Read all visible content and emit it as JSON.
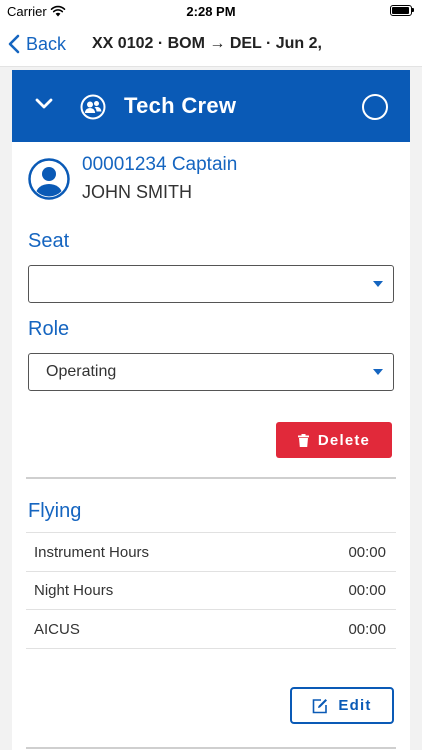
{
  "status_bar": {
    "carrier": "Carrier",
    "time": "2:28 PM"
  },
  "nav": {
    "back_label": "Back",
    "title": "XX 0102 · BOM → DEL · Jun 2,"
  },
  "card": {
    "title": "Tech Crew",
    "crew": {
      "id_rank": "00001234 Captain",
      "name": "JOHN SMITH"
    },
    "seat": {
      "label": "Seat",
      "value": ""
    },
    "role": {
      "label": "Role",
      "value": "Operating"
    },
    "delete_label": "Delete",
    "flying": {
      "title": "Flying",
      "rows": [
        {
          "label": "Instrument Hours",
          "value": "00:00"
        },
        {
          "label": "Night Hours",
          "value": "00:00"
        },
        {
          "label": "AICUS",
          "value": "00:00"
        }
      ]
    },
    "edit_label": "Edit"
  },
  "colors": {
    "header_blue": "#0a5ab6",
    "accent_blue": "#1565c0",
    "danger_red": "#e1293a"
  },
  "icons": {
    "collapse": "chevron-down-icon",
    "crew": "crew-group-icon",
    "avatar": "person-avatar-icon",
    "delete": "trash-icon",
    "edit": "edit-icon"
  }
}
